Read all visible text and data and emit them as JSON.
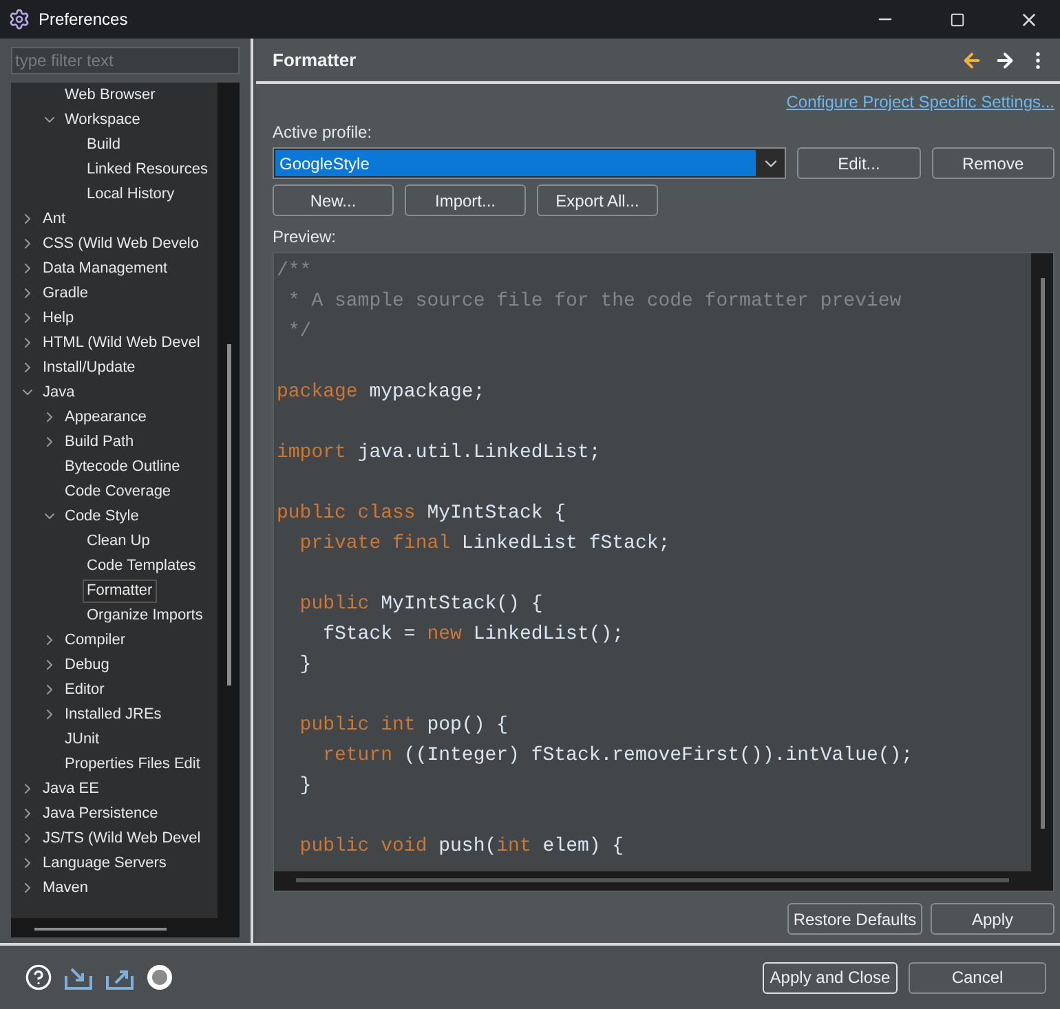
{
  "window": {
    "title": "Preferences"
  },
  "filter": {
    "placeholder": "type filter text"
  },
  "tree": [
    {
      "children": [
        {
          "label": "Web Browser",
          "selected": false
        },
        {
          "label": "Workspace",
          "expanded": true,
          "selected": false,
          "children": [
            {
              "label": "Build",
              "selected": false
            },
            {
              "label": "Linked Resources",
              "selected": false
            },
            {
              "label": "Local History",
              "selected": false
            }
          ]
        }
      ]
    },
    {
      "label": "Ant",
      "expanded": false,
      "selected": false
    },
    {
      "label": "CSS (Wild Web Develo",
      "expanded": false,
      "selected": false
    },
    {
      "label": "Data Management",
      "expanded": false,
      "selected": false
    },
    {
      "label": "Gradle",
      "expanded": false,
      "selected": false
    },
    {
      "label": "Help",
      "expanded": false,
      "selected": false
    },
    {
      "label": "HTML (Wild Web Devel",
      "expanded": false,
      "selected": false
    },
    {
      "label": "Install/Update",
      "expanded": false,
      "selected": false
    },
    {
      "label": "Java",
      "expanded": true,
      "selected": false,
      "children": [
        {
          "label": "Appearance",
          "expanded": false,
          "selected": false
        },
        {
          "label": "Build Path",
          "expanded": false,
          "selected": false
        },
        {
          "label": "Bytecode Outline",
          "selected": false
        },
        {
          "label": "Code Coverage",
          "selected": false
        },
        {
          "label": "Code Style",
          "expanded": true,
          "selected": false,
          "children": [
            {
              "label": "Clean Up",
              "selected": false
            },
            {
              "label": "Code Templates",
              "selected": false
            },
            {
              "label": "Formatter",
              "selected": true
            },
            {
              "label": "Organize Imports",
              "selected": false
            }
          ]
        },
        {
          "label": "Compiler",
          "expanded": false,
          "selected": false
        },
        {
          "label": "Debug",
          "expanded": false,
          "selected": false
        },
        {
          "label": "Editor",
          "expanded": false,
          "selected": false
        },
        {
          "label": "Installed JREs",
          "expanded": false,
          "selected": false
        },
        {
          "label": "JUnit",
          "selected": false
        },
        {
          "label": "Properties Files Edit",
          "selected": false
        }
      ]
    },
    {
      "label": "Java EE",
      "expanded": false,
      "selected": false
    },
    {
      "label": "Java Persistence",
      "expanded": false,
      "selected": false
    },
    {
      "label": "JS/TS (Wild Web Devel",
      "expanded": false,
      "selected": false
    },
    {
      "label": "Language Servers",
      "expanded": false,
      "selected": false
    },
    {
      "label": "Maven",
      "expanded": false,
      "selected": false
    }
  ],
  "page": {
    "title": "Formatter",
    "link": "Configure Project Specific Settings...",
    "profile_label": "Active profile:",
    "profile": "GoogleStyle",
    "profile_buttons": [
      "Edit...",
      "Remove"
    ],
    "buttons": [
      "New...",
      "Import...",
      "Export All..."
    ],
    "preview_label": "Preview:",
    "code": [
      {
        "kind": "code",
        "tokens": [
          {
            "kind": "comment",
            "text": "/**"
          }
        ]
      },
      {
        "kind": "code",
        "tokens": [
          {
            "kind": "comment",
            "text": " * A sample source file for the code formatter preview"
          }
        ]
      },
      {
        "kind": "code",
        "tokens": [
          {
            "kind": "comment",
            "text": " */"
          }
        ]
      },
      {
        "kind": "blank"
      },
      {
        "kind": "code",
        "tokens": [
          {
            "kind": "keyword",
            "text": "package"
          },
          {
            "kind": "plain",
            "text": " mypackage;"
          }
        ]
      },
      {
        "kind": "blank"
      },
      {
        "kind": "code",
        "tokens": [
          {
            "kind": "keyword",
            "text": "import"
          },
          {
            "kind": "plain",
            "text": " java.util.LinkedList;"
          }
        ]
      },
      {
        "kind": "blank"
      },
      {
        "kind": "code",
        "tokens": [
          {
            "kind": "keyword",
            "text": "public class"
          },
          {
            "kind": "plain",
            "text": " MyIntStack {"
          }
        ]
      },
      {
        "kind": "code",
        "tokens": [
          {
            "kind": "keyword",
            "text": "  private final"
          },
          {
            "kind": "plain",
            "text": " LinkedList fStack;"
          }
        ]
      },
      {
        "kind": "blank"
      },
      {
        "kind": "code",
        "tokens": [
          {
            "kind": "keyword",
            "text": "  public"
          },
          {
            "kind": "plain",
            "text": " MyIntStack() {"
          }
        ]
      },
      {
        "kind": "code",
        "tokens": [
          {
            "kind": "plain",
            "text": "    fStack = "
          },
          {
            "kind": "keyword",
            "text": "new"
          },
          {
            "kind": "plain",
            "text": " LinkedList();"
          }
        ]
      },
      {
        "kind": "code",
        "tokens": [
          {
            "kind": "plain",
            "text": "  }"
          }
        ]
      },
      {
        "kind": "blank"
      },
      {
        "kind": "code",
        "tokens": [
          {
            "kind": "keyword",
            "text": "  public int"
          },
          {
            "kind": "plain",
            "text": " pop() {"
          }
        ]
      },
      {
        "kind": "code",
        "tokens": [
          {
            "kind": "keyword",
            "text": "    return"
          },
          {
            "kind": "plain",
            "text": " ((Integer) fStack.removeFirst()).intValue();"
          }
        ]
      },
      {
        "kind": "code",
        "tokens": [
          {
            "kind": "plain",
            "text": "  }"
          }
        ]
      },
      {
        "kind": "blank"
      },
      {
        "kind": "code",
        "tokens": [
          {
            "kind": "keyword",
            "text": "  public void"
          },
          {
            "kind": "plain",
            "text": " push("
          },
          {
            "kind": "keyword",
            "text": "int"
          },
          {
            "kind": "plain",
            "text": " elem) {"
          }
        ]
      }
    ],
    "footer_buttons": [
      "Restore Defaults",
      "Apply"
    ]
  },
  "dialog_buttons": [
    "Apply and Close",
    "Cancel"
  ]
}
